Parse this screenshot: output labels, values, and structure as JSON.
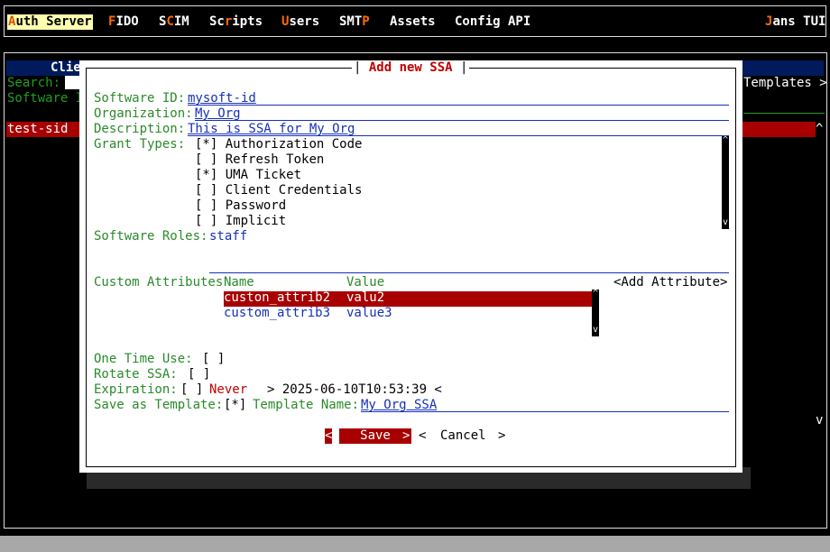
{
  "app": {
    "title": "Jans TUI",
    "menu": [
      {
        "hot": "A",
        "rest": "uth Server",
        "active": true
      },
      {
        "hot": "F",
        "rest": "IDO"
      },
      {
        "pre": "S",
        "hot": "C",
        "rest": "IM"
      },
      {
        "pre": "Sc",
        "hot": "r",
        "rest": "ipts"
      },
      {
        "hot": "U",
        "rest": "sers"
      },
      {
        "pre": "SMT",
        "hot": "P",
        "rest": ""
      },
      {
        "pre": "Assets",
        "hot": "",
        "rest": ""
      },
      {
        "pre": "Config API",
        "hot": "",
        "rest": ""
      }
    ],
    "title_hot": "J",
    "title_rest": "ans TUI"
  },
  "background": {
    "panel_title_fragment": "Clie",
    "search_label": "Search:",
    "software_id_col": "Software I",
    "templates_link": "Templates >",
    "selected_row": "test-sid",
    "scroll_up": "^",
    "scroll_down": "v"
  },
  "dialog": {
    "title": "Add new SSA",
    "software_id": {
      "label": "Software ID:",
      "value": "mysoft-id"
    },
    "organization": {
      "label": "Organization:",
      "value": "My Org"
    },
    "description": {
      "label": "Description:",
      "value": "This is SSA for My Org"
    },
    "grant_types": {
      "label": "Grant Types:",
      "items": [
        {
          "mark": "[*]",
          "label": "Authorization Code"
        },
        {
          "mark": "[ ]",
          "label": "Refresh Token"
        },
        {
          "mark": "[*]",
          "label": "UMA Ticket"
        },
        {
          "mark": "[ ]",
          "label": "Client Credentials"
        },
        {
          "mark": "[ ]",
          "label": "Password"
        },
        {
          "mark": "[ ]",
          "label": "Implicit"
        }
      ]
    },
    "software_roles": {
      "label": "Software Roles:",
      "value": "staff"
    },
    "custom_attributes": {
      "label": "Custom Attributes",
      "columns": [
        "Name",
        "Value"
      ],
      "add_button": "<Add Attribute>",
      "rows": [
        {
          "name": "custon_attrib2",
          "value": "valu2"
        },
        {
          "name": "custom_attrib3",
          "value": "value3"
        }
      ]
    },
    "one_time_use": {
      "label": "One Time Use:",
      "mark": "[ ]"
    },
    "rotate_ssa": {
      "label": "Rotate SSA:",
      "mark": "[ ]"
    },
    "expiration": {
      "label": "Expiration:",
      "mark": "[ ]",
      "never": "Never",
      "date": "> 2025-06-10T10:53:39 <"
    },
    "save_as_template": {
      "label": "Save as Template:",
      "mark": "[*]",
      "name_label": "Template Name:",
      "name_value": "My Org SSA"
    },
    "buttons": {
      "save": "Save",
      "cancel": "Cancel",
      "lt": "<",
      "gt": ">"
    },
    "scroll_up": "^",
    "scroll_down": "v"
  }
}
